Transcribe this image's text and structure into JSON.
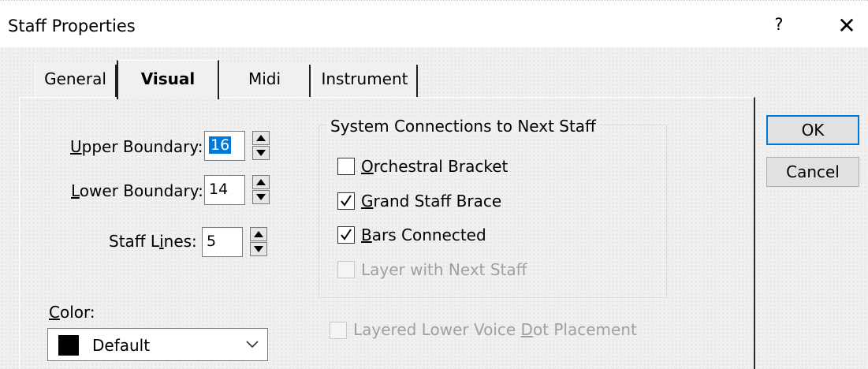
{
  "window": {
    "title": "Staff Properties",
    "help_glyph": "?",
    "close_glyph": "✕"
  },
  "tabs": [
    {
      "label": "General",
      "selected": false
    },
    {
      "label": "Visual",
      "selected": true
    },
    {
      "label": "Midi",
      "selected": false
    },
    {
      "label": "Instrument",
      "selected": false
    }
  ],
  "fields": {
    "upper_boundary": {
      "label_mnemonic": "U",
      "label_rest": "pper Boundary:",
      "value": "16"
    },
    "lower_boundary": {
      "label_mnemonic": "L",
      "label_rest": "ower Boundary:",
      "value": "14"
    },
    "staff_lines": {
      "label_pre": "Staff L",
      "label_mnemonic": "i",
      "label_rest": "nes:",
      "value": "5"
    }
  },
  "system_connections": {
    "title": "System Connections to Next Staff",
    "options": [
      {
        "mnemonic": "O",
        "rest": "rchestral Bracket",
        "checked": false,
        "enabled": true
      },
      {
        "mnemonic": "G",
        "rest": "rand Staff Brace",
        "checked": true,
        "enabled": true
      },
      {
        "mnemonic": "B",
        "rest": "ars Connected",
        "checked": true,
        "enabled": true
      },
      {
        "mnemonic": "",
        "rest": "Layer with Next Staff",
        "checked": false,
        "enabled": false
      }
    ]
  },
  "layered_dot": {
    "label_pre": "Layered Lower Voice ",
    "label_mnemonic": "D",
    "label_rest": "ot Placement",
    "checked": false,
    "enabled": false
  },
  "color": {
    "label_mnemonic": "C",
    "label_rest": "olor:",
    "selected": "Default",
    "swatch": "#000000"
  },
  "buttons": {
    "ok": "OK",
    "cancel": "Cancel"
  },
  "theme": {
    "selection_color": "#0078d7",
    "disabled_text": "#a0a0a0"
  }
}
